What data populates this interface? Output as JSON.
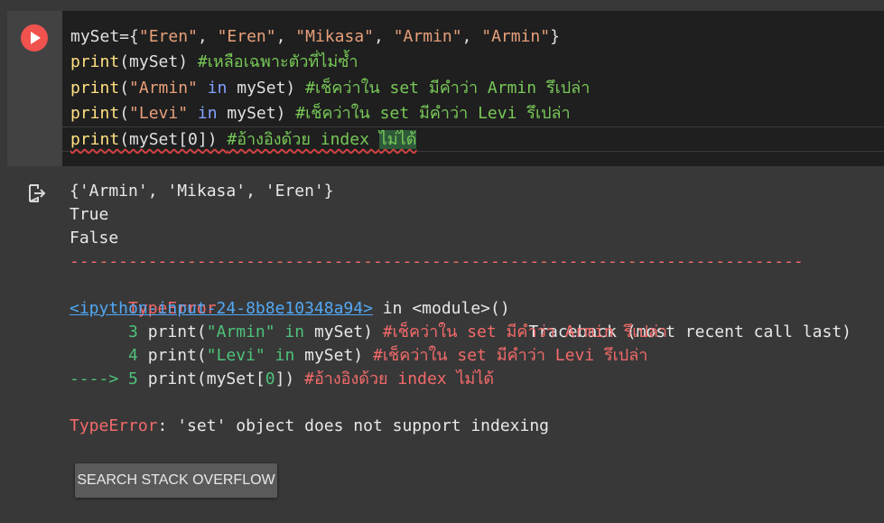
{
  "editor": {
    "line1": {
      "a": "mySet={",
      "s1": "\"Eren\"",
      "c1": ", ",
      "s2": "\"Eren\"",
      "c2": ", ",
      "s3": "\"Mikasa\"",
      "c3": ", ",
      "s4": "\"Armin\"",
      "c4": ", ",
      "s5": "\"Armin\"",
      "b": "}"
    },
    "line2": {
      "fn": "print",
      "a": "(mySet) ",
      "cm": "#เหลือเฉพาะตัวที่ไม่ซ้ำ"
    },
    "line3": {
      "fn": "print",
      "a": "(",
      "s": "\"Armin\"",
      "kw": " in ",
      "b": "mySet) ",
      "cm": "#เช็คว่าใน set มีคำว่า Armin รึเปล่า"
    },
    "line4": {
      "fn": "print",
      "a": "(",
      "s": "\"Levi\"",
      "kw": " in ",
      "b": "mySet) ",
      "cm": "#เช็คว่าใน set มีคำว่า Levi รึเปล่า"
    },
    "line5": {
      "fn": "print",
      "a": "(mySet[0]) ",
      "cm1": "#อ้างอิงด้วย index ",
      "cm2": "ไม่ได้"
    }
  },
  "output": {
    "l1": "{'Armin', 'Mikasa', 'Eren'}",
    "l2": "True",
    "l3": "False",
    "dashes": "---------------------------------------------------------------------------",
    "err_name": "TypeError",
    "traceback": "Traceback (most recent call last)",
    "link": "<ipython-input-24-8b8e10348a94>",
    "in_module_a": " in ",
    "in_module_b": "<module>()",
    "tb3": {
      "num": "      3 ",
      "fn": "print",
      "a": "(",
      "s": "\"Armin\"",
      "kw": " in ",
      "b": "mySet) ",
      "cm": "#เช็คว่าใน set มีคำว่า Armin รึเปล่า"
    },
    "tb4": {
      "num": "      4 ",
      "fn": "print",
      "a": "(",
      "s": "\"Levi\"",
      "kw": " in ",
      "b": "mySet) ",
      "cm": "#เช็คว่าใน set มีคำว่า Levi รึเปล่า"
    },
    "tb5": {
      "arrow": "----> 5 ",
      "fn": "print",
      "a": "(mySet[",
      "n": "0",
      "b": "]) ",
      "cm": "#อ้างอิงด้วย index ไม่ได้"
    },
    "final_name": "TypeError",
    "final_msg": ": 'set' object does not support indexing",
    "so_button": "SEARCH STACK OVERFLOW"
  },
  "colors": {
    "run_button": "#f0524d",
    "editor_bg": "#1f1f1f",
    "output_bg": "#383838"
  }
}
